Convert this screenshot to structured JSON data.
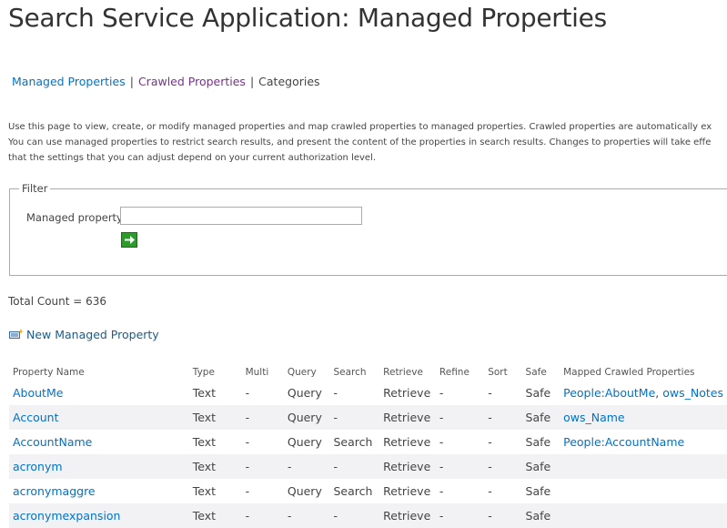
{
  "page": {
    "title": "Search Service Application: Managed Properties"
  },
  "nav": {
    "managed_properties": "Managed Properties",
    "separator": "|",
    "crawled_properties": "Crawled Properties",
    "categories": "Categories"
  },
  "description": {
    "line1": "Use this page to view, create, or modify managed properties and map crawled properties to managed properties. Crawled properties are automatically ex",
    "line2": "You can use managed properties to restrict search results, and present the content of the properties in search results. Changes to properties will take effe",
    "line3": "that the settings that you can adjust depend on your current authorization level."
  },
  "filter": {
    "legend": "Filter",
    "label": "Managed property",
    "value": "",
    "go_icon": "arrow-right-icon"
  },
  "total_count": "Total Count = 636",
  "new_property": {
    "label": "New Managed Property",
    "icon": "new-item-icon"
  },
  "table": {
    "headers": [
      "Property Name",
      "Type",
      "Multi",
      "Query",
      "Search",
      "Retrieve",
      "Refine",
      "Sort",
      "Safe",
      "Mapped Crawled Properties"
    ],
    "rows": [
      {
        "name": "AboutMe",
        "type": "Text",
        "multi": "-",
        "query": "Query",
        "search": "-",
        "retrieve": "Retrieve",
        "refine": "-",
        "sort": "-",
        "safe": "Safe",
        "mapped": [
          "People:AboutMe",
          "ows_Notes"
        ]
      },
      {
        "name": "Account",
        "type": "Text",
        "multi": "-",
        "query": "Query",
        "search": "-",
        "retrieve": "Retrieve",
        "refine": "-",
        "sort": "-",
        "safe": "Safe",
        "mapped": [
          "ows_Name"
        ]
      },
      {
        "name": "AccountName",
        "type": "Text",
        "multi": "-",
        "query": "Query",
        "search": "Search",
        "retrieve": "Retrieve",
        "refine": "-",
        "sort": "-",
        "safe": "Safe",
        "mapped": [
          "People:AccountName"
        ]
      },
      {
        "name": "acronym",
        "type": "Text",
        "multi": "-",
        "query": "-",
        "search": "-",
        "retrieve": "Retrieve",
        "refine": "-",
        "sort": "-",
        "safe": "Safe",
        "mapped": []
      },
      {
        "name": "acronymaggre",
        "type": "Text",
        "multi": "-",
        "query": "Query",
        "search": "Search",
        "retrieve": "Retrieve",
        "refine": "-",
        "sort": "-",
        "safe": "Safe",
        "mapped": []
      },
      {
        "name": "acronymexpansion",
        "type": "Text",
        "multi": "-",
        "query": "-",
        "search": "-",
        "retrieve": "Retrieve",
        "refine": "-",
        "sort": "-",
        "safe": "Safe",
        "mapped": []
      }
    ]
  }
}
